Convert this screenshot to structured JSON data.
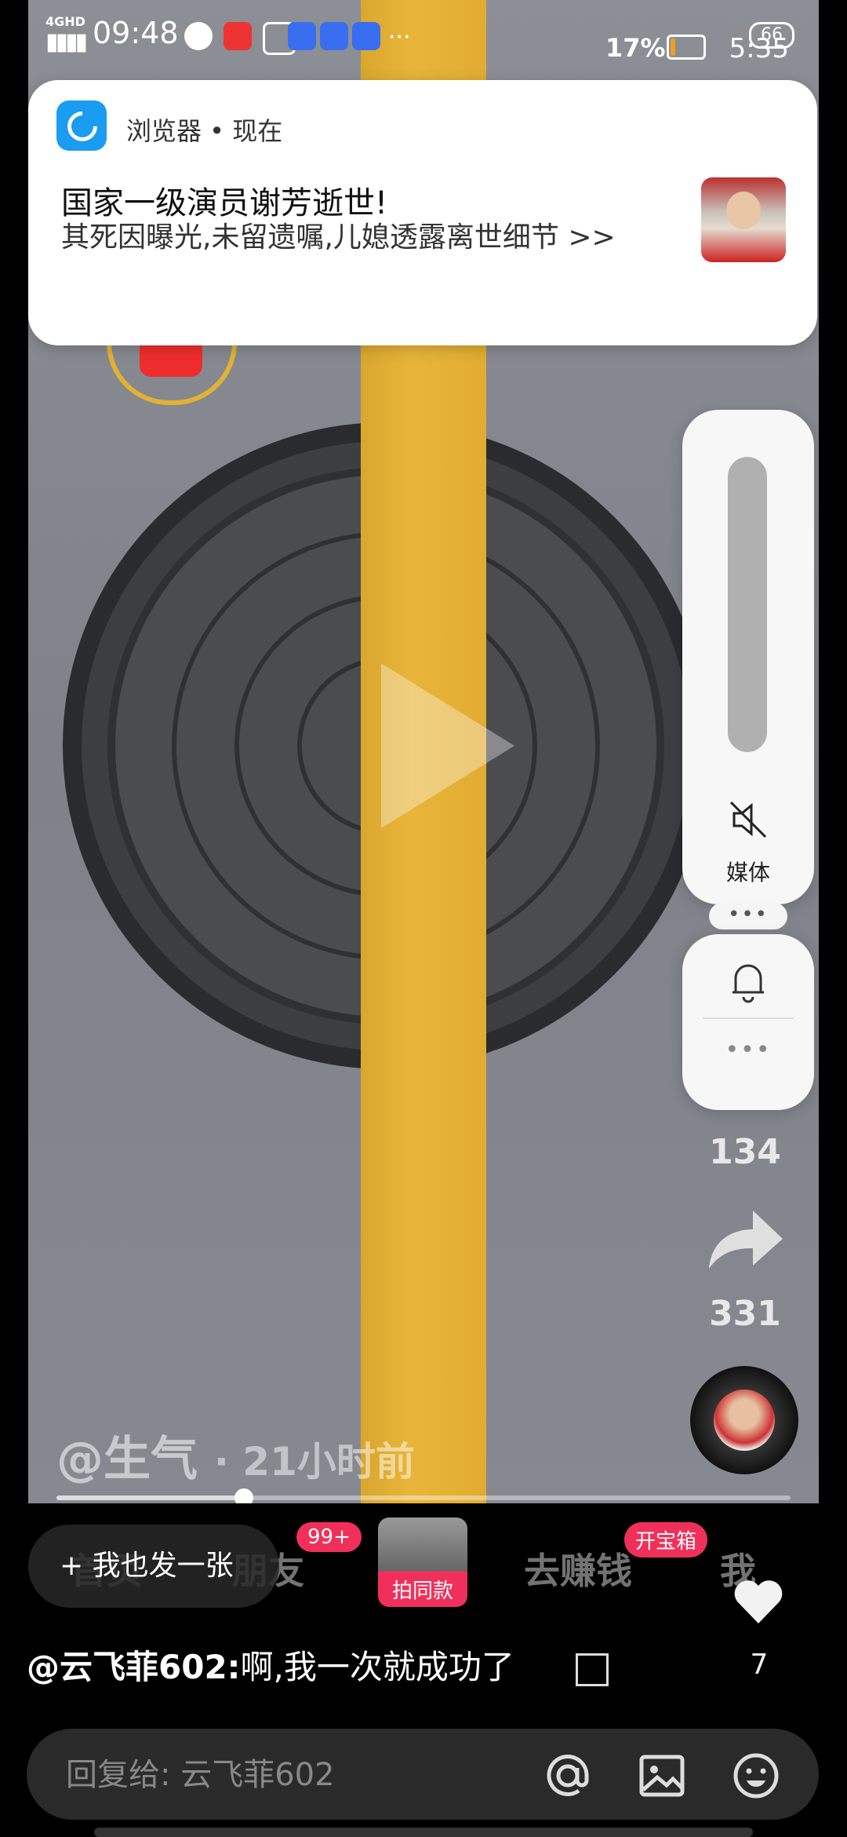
{
  "status_bar": {
    "network": "4GHD",
    "time": "09:48",
    "battery_percent": "17%",
    "battery_level": 0.17,
    "wifi_badge": "66",
    "time_right": "5:35"
  },
  "notification": {
    "app_name": "浏览器 • 现在",
    "title": "国家一级演员谢芳逝世!",
    "body": "其死因曝光,未留遗嘱,儿媳透露离世细节 >>"
  },
  "volume_panel": {
    "media_label": "媒体",
    "dots": "•••",
    "more": "•••"
  },
  "video": {
    "author": "@生气",
    "time_ago": "· 21小时前",
    "comment_count": "134",
    "share_count": "331",
    "progress": 0.255
  },
  "bottom_nav": {
    "items": [
      "首页",
      "朋友",
      "去赚钱",
      "我"
    ],
    "friends_badge": "99+",
    "treasure_badge": "开宝箱",
    "same_style_label": "拍同款"
  },
  "post_button": "+ 我也发一张",
  "like_count": "7",
  "comment": {
    "user": "@云飞菲602:",
    "text": "啊,我一次就成功了"
  },
  "reply": {
    "placeholder": "回复给: 云飞菲602"
  },
  "colors": {
    "stripe": "#e8b53a",
    "badge_pink": "#f0305a",
    "browser_blue": "#1a9cf0"
  }
}
